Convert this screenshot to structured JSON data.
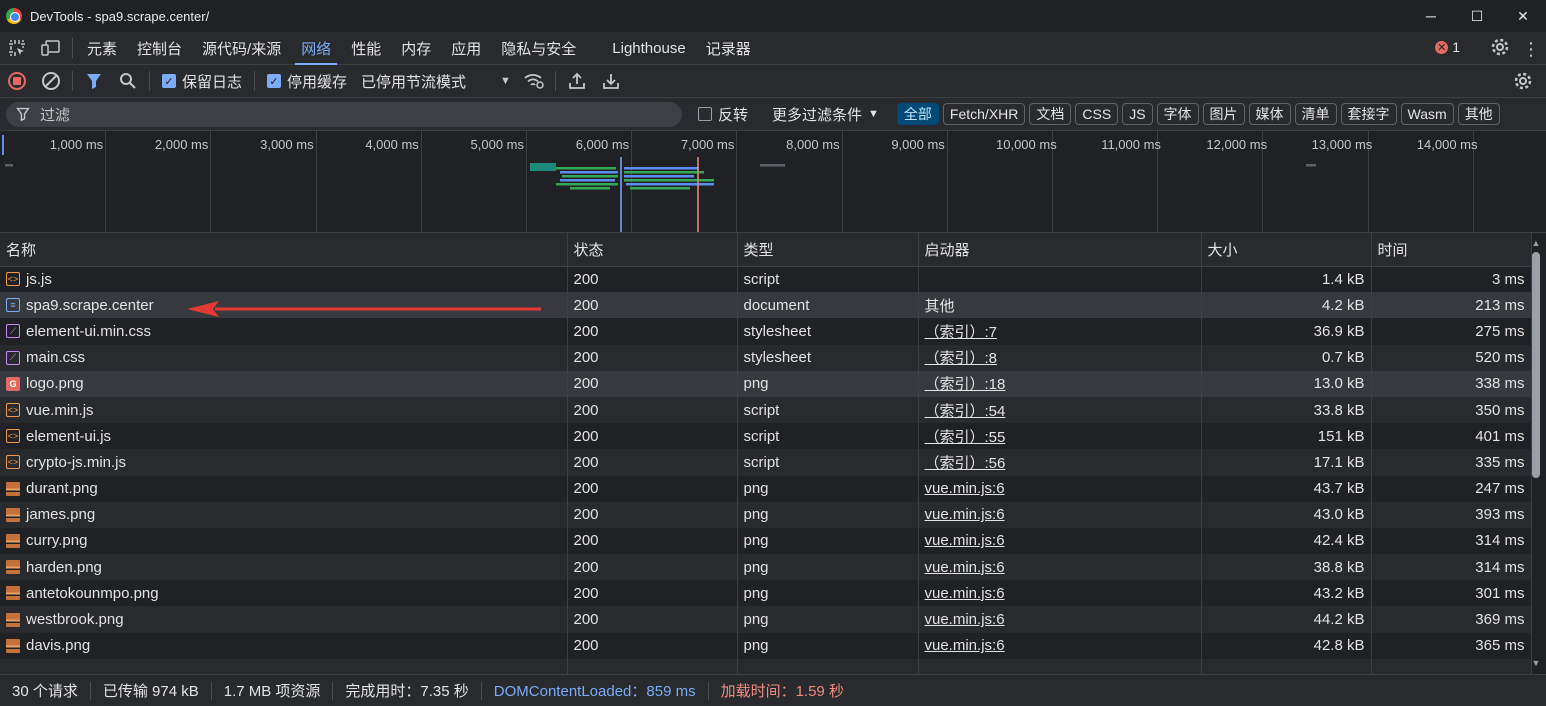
{
  "window": {
    "title": "DevTools - spa9.scrape.center/",
    "minimize_label": "─",
    "maximize_label": "☐",
    "close_label": "✕"
  },
  "panel_tabs": [
    {
      "label": "元素"
    },
    {
      "label": "控制台"
    },
    {
      "label": "源代码/来源"
    },
    {
      "label": "网络",
      "active": true
    },
    {
      "label": "性能"
    },
    {
      "label": "内存"
    },
    {
      "label": "应用"
    },
    {
      "label": "隐私与安全"
    },
    {
      "label": "Lighthouse"
    },
    {
      "label": "记录器"
    }
  ],
  "error_count": "1",
  "toolbar": {
    "preserve_log_label": "保留日志",
    "preserve_log_checked": true,
    "disable_cache_label": "停用缓存",
    "disable_cache_checked": true,
    "throttle_label": "已停用节流模式"
  },
  "filter": {
    "placeholder": "过滤",
    "invert_label": "反转",
    "more_filters_label": "更多过滤条件",
    "types": [
      "全部",
      "Fetch/XHR",
      "文档",
      "CSS",
      "JS",
      "字体",
      "图片",
      "媒体",
      "清单",
      "套接字",
      "Wasm",
      "其他"
    ],
    "active_type": "全部"
  },
  "overview": {
    "ticks": [
      "1,000 ms",
      "2,000 ms",
      "3,000 ms",
      "4,000 ms",
      "5,000 ms",
      "6,000 ms",
      "7,000 ms",
      "8,000 ms",
      "9,000 ms",
      "10,000 ms",
      "11,000 ms",
      "12,000 ms",
      "13,000 ms",
      "14,000 ms",
      "15,0"
    ],
    "colors": {
      "domcontentloaded": "#7cacf8",
      "load": "#f28b82",
      "script": "#5b8def",
      "image": "#34a853",
      "document": "#1e8a7a"
    }
  },
  "table": {
    "columns": [
      "名称",
      "状态",
      "类型",
      "启动器",
      "大小",
      "时间"
    ],
    "rows": [
      {
        "name": "js.js",
        "icon": "script",
        "status": "200",
        "type": "script",
        "initiator": "",
        "initiator_link": false,
        "size": "1.4 kB",
        "time": "3 ms"
      },
      {
        "name": "spa9.scrape.center",
        "icon": "document",
        "status": "200",
        "type": "document",
        "initiator": "其他",
        "initiator_link": false,
        "size": "4.2 kB",
        "time": "213 ms",
        "selected": true
      },
      {
        "name": "element-ui.min.css",
        "icon": "css",
        "status": "200",
        "type": "stylesheet",
        "initiator": "（索引）:7",
        "initiator_link": true,
        "size": "36.9 kB",
        "time": "275 ms"
      },
      {
        "name": "main.css",
        "icon": "css",
        "status": "200",
        "type": "stylesheet",
        "initiator": "（索引）:8",
        "initiator_link": true,
        "size": "0.7 kB",
        "time": "520 ms"
      },
      {
        "name": "logo.png",
        "icon": "png-logo",
        "status": "200",
        "type": "png",
        "initiator": "（索引）:18",
        "initiator_link": true,
        "size": "13.0 kB",
        "time": "338 ms",
        "selected": true
      },
      {
        "name": "vue.min.js",
        "icon": "script",
        "status": "200",
        "type": "script",
        "initiator": "（索引）:54",
        "initiator_link": true,
        "size": "33.8 kB",
        "time": "350 ms"
      },
      {
        "name": "element-ui.js",
        "icon": "script",
        "status": "200",
        "type": "script",
        "initiator": "（索引）:55",
        "initiator_link": true,
        "size": "151 kB",
        "time": "401 ms"
      },
      {
        "name": "crypto-js.min.js",
        "icon": "script",
        "status": "200",
        "type": "script",
        "initiator": "（索引）:56",
        "initiator_link": true,
        "size": "17.1 kB",
        "time": "335 ms"
      },
      {
        "name": "durant.png",
        "icon": "avatar",
        "status": "200",
        "type": "png",
        "initiator": "vue.min.js:6",
        "initiator_link": true,
        "size": "43.7 kB",
        "time": "247 ms"
      },
      {
        "name": "james.png",
        "icon": "avatar",
        "status": "200",
        "type": "png",
        "initiator": "vue.min.js:6",
        "initiator_link": true,
        "size": "43.0 kB",
        "time": "393 ms"
      },
      {
        "name": "curry.png",
        "icon": "avatar",
        "status": "200",
        "type": "png",
        "initiator": "vue.min.js:6",
        "initiator_link": true,
        "size": "42.4 kB",
        "time": "314 ms"
      },
      {
        "name": "harden.png",
        "icon": "avatar",
        "status": "200",
        "type": "png",
        "initiator": "vue.min.js:6",
        "initiator_link": true,
        "size": "38.8 kB",
        "time": "314 ms"
      },
      {
        "name": "antetokounmpo.png",
        "icon": "avatar",
        "status": "200",
        "type": "png",
        "initiator": "vue.min.js:6",
        "initiator_link": true,
        "size": "43.2 kB",
        "time": "301 ms"
      },
      {
        "name": "westbrook.png",
        "icon": "avatar",
        "status": "200",
        "type": "png",
        "initiator": "vue.min.js:6",
        "initiator_link": true,
        "size": "44.2 kB",
        "time": "369 ms"
      },
      {
        "name": "davis.png",
        "icon": "avatar",
        "status": "200",
        "type": "png",
        "initiator": "vue.min.js:6",
        "initiator_link": true,
        "size": "42.8 kB",
        "time": "365 ms"
      }
    ]
  },
  "status_bar": {
    "requests": "30 个请求",
    "transferred": "已传输 974 kB",
    "resources": "1.7 MB 项资源",
    "finish": "完成用时：7.35 秒",
    "dom_content_loaded": "DOMContentLoaded：859 ms",
    "load": "加载时间：1.59 秒"
  }
}
